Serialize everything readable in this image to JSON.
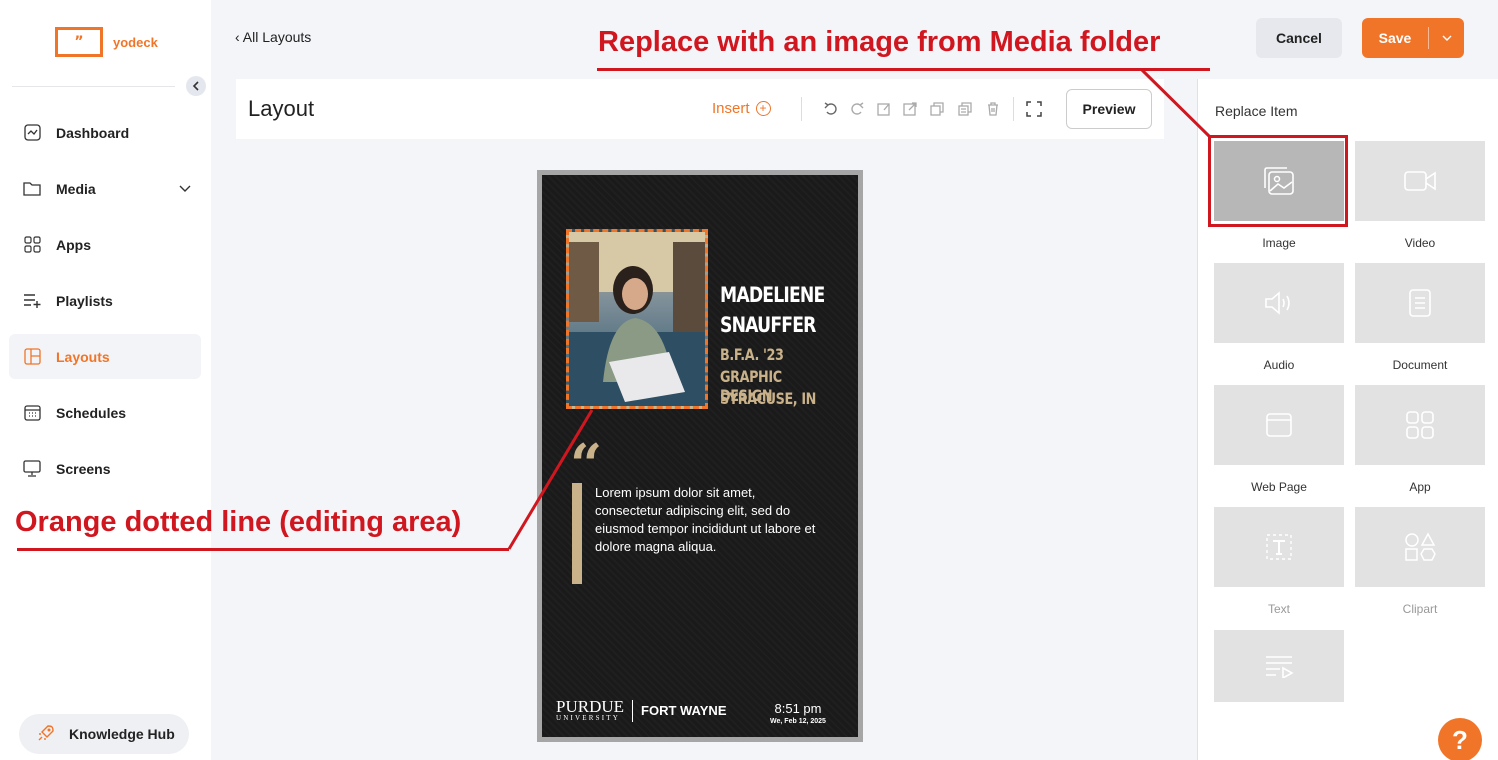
{
  "brand": {
    "logo_glyph": "\"",
    "name": "yodeck",
    "accent": "#f07528"
  },
  "sidebar": {
    "items": [
      {
        "label": "Dashboard",
        "icon": "dashboard-icon"
      },
      {
        "label": "Media",
        "icon": "folder-icon"
      },
      {
        "label": "Apps",
        "icon": "apps-grid-icon"
      },
      {
        "label": "Playlists",
        "icon": "playlist-icon"
      },
      {
        "label": "Layouts",
        "icon": "layouts-icon",
        "active": true
      },
      {
        "label": "Schedules",
        "icon": "calendar-icon"
      },
      {
        "label": "Screens",
        "icon": "monitor-icon"
      }
    ],
    "knowledge_hub": "Knowledge Hub"
  },
  "header": {
    "back": "All Layouts",
    "cancel": "Cancel",
    "save": "Save"
  },
  "toolbar": {
    "title": "Layout",
    "insert": "Insert",
    "preview": "Preview"
  },
  "canvas": {
    "name_line1": "MADELIENE",
    "name_line2": "SNAUFFER",
    "degree": "B.F.A. '23",
    "major": "GRAPHIC DESIGN",
    "hometown": "SYRACUSE, IN",
    "quote": "Lorem ipsum dolor sit amet, consectetur adipiscing elit, sed do eiusmod tempor incididunt ut labore et dolore magna aliqua.",
    "purdue": "PURDUE",
    "university": "UNIVERSITY",
    "campus": "FORT WAYNE",
    "time": "8:51 pm",
    "date": "We, Feb 12, 2025"
  },
  "replace_panel": {
    "title": "Replace Item",
    "items": [
      {
        "label": "Image",
        "icon": "image-icon",
        "selected": true
      },
      {
        "label": "Video",
        "icon": "video-icon"
      },
      {
        "label": "Audio",
        "icon": "audio-icon"
      },
      {
        "label": "Document",
        "icon": "document-icon"
      },
      {
        "label": "Web Page",
        "icon": "webpage-icon"
      },
      {
        "label": "App",
        "icon": "app-icon"
      },
      {
        "label": "Text",
        "icon": "text-icon",
        "disabled": true
      },
      {
        "label": "Clipart",
        "icon": "clipart-icon",
        "disabled": true
      },
      {
        "label": "",
        "icon": "playlist-media-icon"
      }
    ]
  },
  "annotations": {
    "top": "Replace with an image from Media folder",
    "left": "Orange dotted line (editing area)",
    "color": "#d0171f"
  },
  "help": "?"
}
